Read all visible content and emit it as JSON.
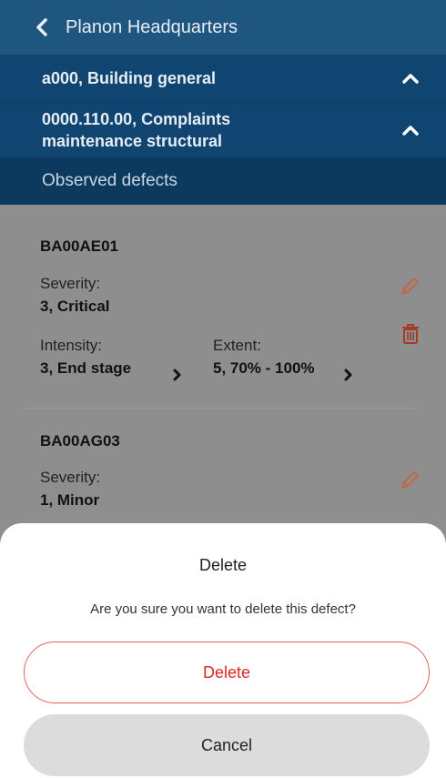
{
  "header": {
    "back_label": "Planon Headquarters",
    "level1": "a000, Building general",
    "level2_line1": "0000.110.00, Complaints",
    "level2_line2": "maintenance structural",
    "section": "Observed defects"
  },
  "defects": [
    {
      "code": "BA00AE01",
      "severity_label": "Severity:",
      "severity": "3, Critical",
      "intensity_label": "Intensity:",
      "intensity": "3, End stage",
      "extent_label": "Extent:",
      "extent": "5, 70% - 100%"
    },
    {
      "code": "BA00AG03",
      "severity_label": "Severity:",
      "severity": "1, Minor"
    }
  ],
  "dialog": {
    "title": "Delete",
    "message": "Are you sure you want to delete this defect?",
    "delete_label": "Delete",
    "cancel_label": "Cancel"
  },
  "colors": {
    "header_top": "#1f5680",
    "header_rows": "#0f4570",
    "header_section": "#0c3a5f",
    "dim_background": "#8e8e8e",
    "accent_red": "#e02525",
    "edit_icon": "#c0684a"
  },
  "icons": [
    "chevron-left-icon",
    "chevron-up-icon",
    "pencil-icon",
    "trash-icon",
    "chevron-right-icon"
  ]
}
